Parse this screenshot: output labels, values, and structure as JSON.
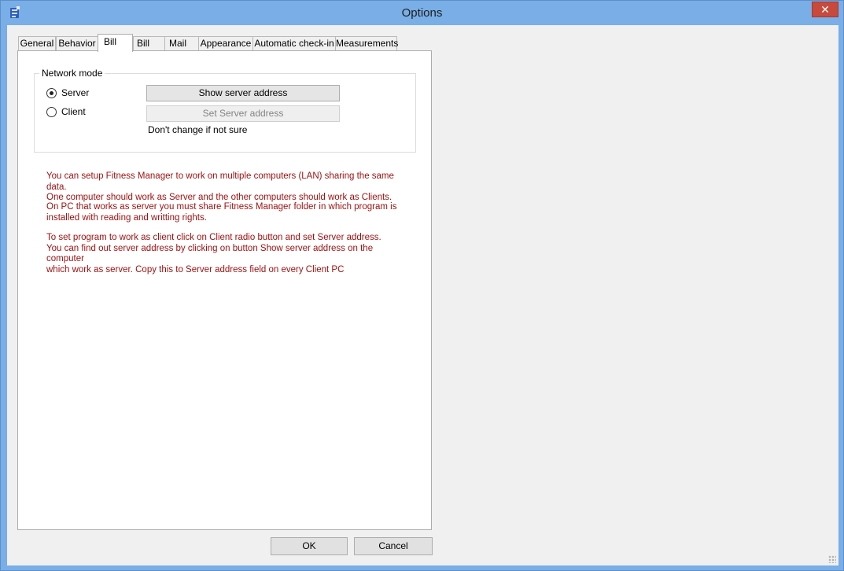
{
  "window": {
    "title": "Options",
    "close_glyph": "✕"
  },
  "tabs": [
    {
      "label": "General"
    },
    {
      "label": "Behavior"
    },
    {
      "label": "Bill"
    },
    {
      "label": "Bill"
    },
    {
      "label": "Mail"
    },
    {
      "label": "Appearance"
    },
    {
      "label": "Automatic check-in"
    },
    {
      "label": "Measurements"
    }
  ],
  "network": {
    "group_label": "Network mode",
    "server_label": "Server",
    "client_label": "Client",
    "selected": "Server",
    "show_address_button": "Show server address",
    "set_address_button": "Set Server address",
    "hint": "Don't change if not sure"
  },
  "info": {
    "para1_line1": "You can setup Fitness Manager to work on multiple computers (LAN) sharing the same data.",
    "para1_line2": "One computer should work as Server and the other computers should work as Clients.",
    "para2_line1": "On PC that works as server you must share Fitness Manager folder in which program is",
    "para2_line2": "installed with reading and writting rights.",
    "para3_line1": "To set program to work as client click on Client radio button and set Server address.",
    "para3_line2": "You can find out server address by clicking on button Show server address on the computer",
    "para3_line3": "which work as server. Copy this to Server address field on every Client PC"
  },
  "footer": {
    "ok_label": "OK",
    "cancel_label": "Cancel"
  },
  "colors": {
    "info_text": "#9b1010",
    "frame": "#79aee6",
    "close_button": "#c74a3d"
  },
  "icons": {
    "app": "app-logo-icon",
    "close": "close-icon",
    "grip": "resize-grip-icon"
  }
}
